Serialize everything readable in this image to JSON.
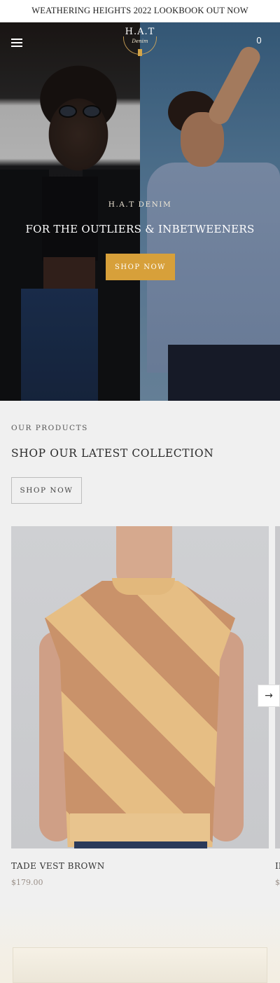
{
  "announcement": {
    "text": "WEATHERING HEIGHTS 2022 LOOKBOOK OUT NOW"
  },
  "header": {
    "logo_main": "H.A.T",
    "logo_sub": "Denim",
    "cart_count": "0"
  },
  "hero": {
    "kicker": "H.A.T DENIM",
    "heading": "FOR THE OUTLIERS & INBETWEENERS",
    "cta_label": "SHOP NOW"
  },
  "products_section": {
    "kicker": "OUR PRODUCTS",
    "title": "SHOP OUR LATEST COLLECTION",
    "cta_label": "SHOP NOW",
    "items": [
      {
        "name": "TADE VEST BROWN",
        "price": "$179.00"
      },
      {
        "name": "IF",
        "price": "$"
      }
    ],
    "next_arrow": "→"
  },
  "colors": {
    "accent": "#d7a03a",
    "price": "#9a8f88",
    "background": "#f0f0f0"
  },
  "icons": {
    "menu": "hamburger-icon",
    "cart": "cart-count",
    "carousel_next": "arrow-right-icon"
  }
}
